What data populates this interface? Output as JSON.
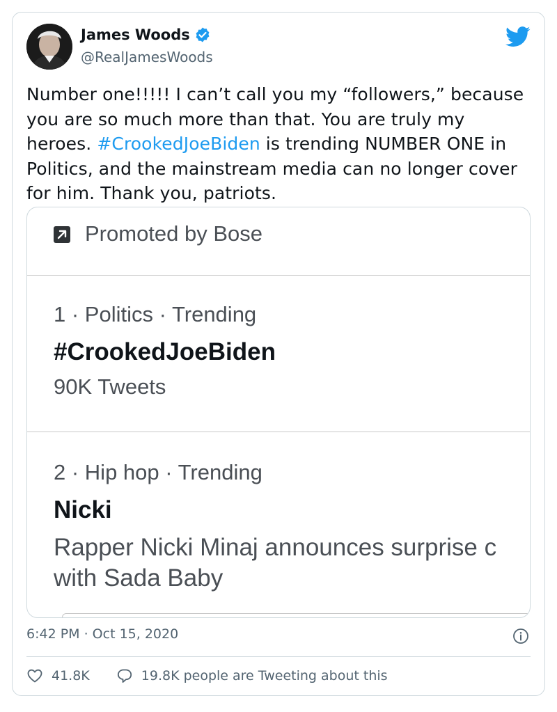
{
  "author": {
    "name": "James Woods",
    "handle": "@RealJamesWoods",
    "verified": true
  },
  "tweet": {
    "text_before": "Number one!!!!! I can’t call you my “followers,” because you are so much more than that. You are truly my heroes. ",
    "hashtag": "#CrookedJoeBiden",
    "text_after": " is trending NUMBER ONE in Politics,  and the mainstream media can no longer cover for him. Thank you, patriots."
  },
  "media": {
    "promoted": "Promoted by Bose",
    "trends": [
      {
        "meta": "1 · Politics · Trending",
        "name": "#CrookedJoeBiden",
        "count": "90K Tweets"
      },
      {
        "meta": "2 · Hip hop · Trending",
        "name": "Nicki",
        "desc_line1": "Rapper Nicki Minaj announces surprise c",
        "desc_line2": "with Sada Baby"
      }
    ]
  },
  "footer": {
    "timestamp": "6:42 PM · Oct 15, 2020",
    "likes": "41.8K",
    "replies_text": "19.8K people are Tweeting about this"
  },
  "icons": {
    "brand": "twitter-bird-icon",
    "verified": "verified-badge-icon",
    "info": "info-icon",
    "like": "heart-icon",
    "reply": "speech-bubble-icon",
    "promoted": "promoted-arrow-icon"
  },
  "colors": {
    "accent": "#1d9bf0",
    "text": "#0f1419",
    "muted": "#536471",
    "border": "#cfd9de"
  }
}
